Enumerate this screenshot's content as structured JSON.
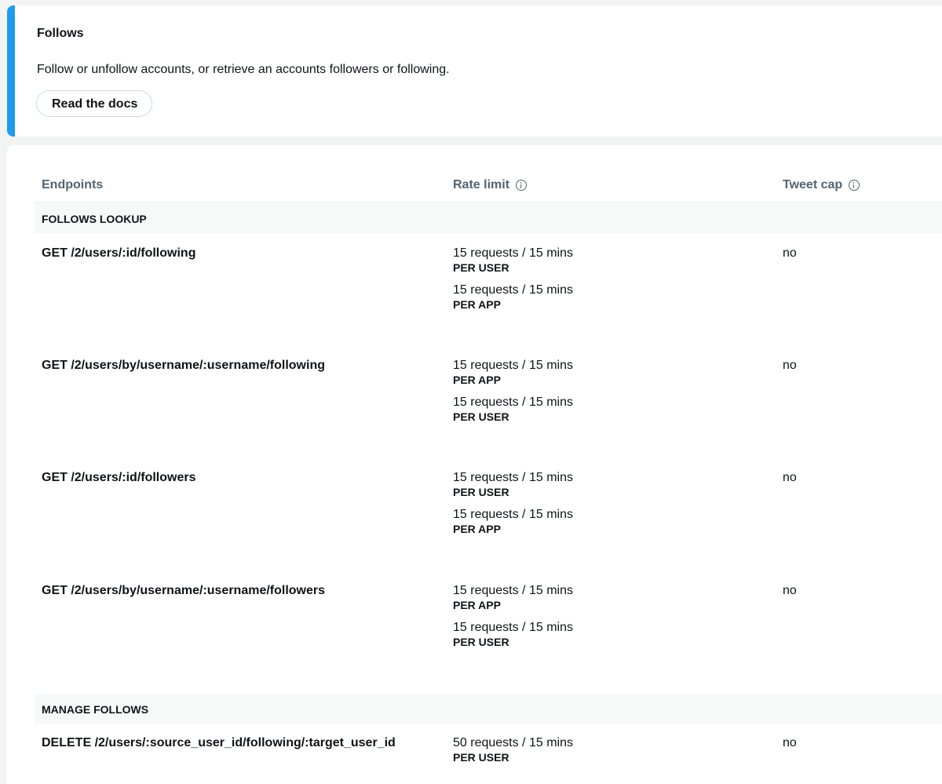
{
  "header": {
    "title": "Follows",
    "description": "Follow or unfollow accounts, or retrieve an accounts followers or following.",
    "docs_button": "Read the docs"
  },
  "table": {
    "columns": {
      "endpoints": "Endpoints",
      "rate_limit": "Rate limit",
      "tweet_cap": "Tweet cap"
    },
    "sections": [
      {
        "title": "FOLLOWS LOOKUP",
        "rows": [
          {
            "endpoint": "GET /2/users/:id/following",
            "limits": [
              {
                "requests": "15 requests / 15 mins",
                "scope": "PER USER"
              },
              {
                "requests": "15 requests / 15 mins",
                "scope": "PER APP"
              }
            ],
            "cap": "no"
          },
          {
            "endpoint": "GET /2/users/by/username/:username/following",
            "limits": [
              {
                "requests": "15 requests / 15 mins",
                "scope": "PER APP"
              },
              {
                "requests": "15 requests / 15 mins",
                "scope": "PER USER"
              }
            ],
            "cap": "no"
          },
          {
            "endpoint": "GET /2/users/:id/followers",
            "limits": [
              {
                "requests": "15 requests / 15 mins",
                "scope": "PER USER"
              },
              {
                "requests": "15 requests / 15 mins",
                "scope": "PER APP"
              }
            ],
            "cap": "no"
          },
          {
            "endpoint": "GET /2/users/by/username/:username/followers",
            "limits": [
              {
                "requests": "15 requests / 15 mins",
                "scope": "PER APP"
              },
              {
                "requests": "15 requests / 15 mins",
                "scope": "PER USER"
              }
            ],
            "cap": "no"
          }
        ]
      },
      {
        "title": "MANAGE FOLLOWS",
        "rows": [
          {
            "endpoint": "DELETE /2/users/:source_user_id/following/:target_user_id",
            "limits": [
              {
                "requests": "50 requests / 15 mins",
                "scope": "PER USER"
              }
            ],
            "cap": "no"
          }
        ]
      }
    ]
  },
  "colors": {
    "accent": "#1d9bf0",
    "header_text": "#536471",
    "section_bg": "#f7f9f9"
  },
  "icons": {
    "info": "info-circle-icon"
  }
}
